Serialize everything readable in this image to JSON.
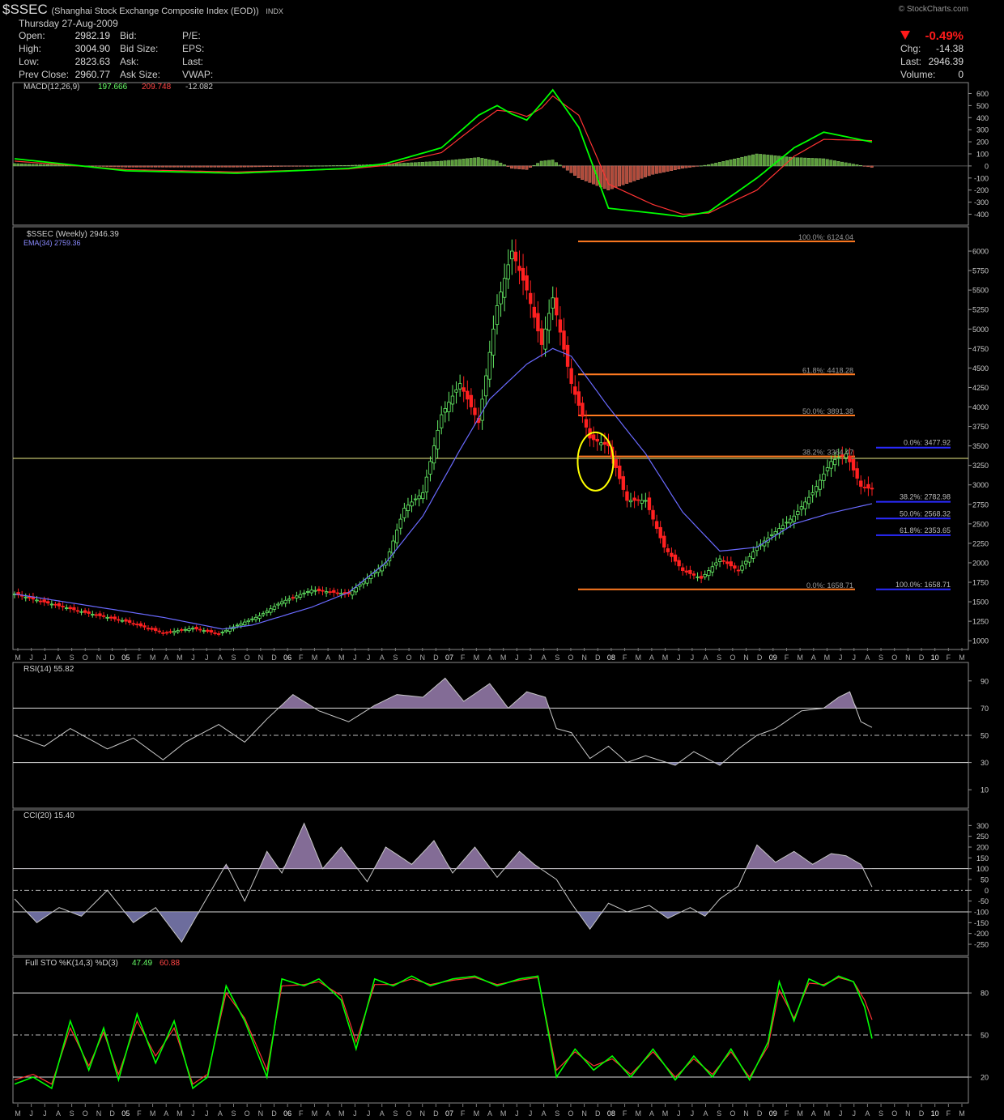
{
  "header": {
    "symbol": "$SSEC",
    "name": "(Shanghai Stock Exchange Composite Index (EOD))",
    "exchange": "INDX",
    "date": "Thursday  27-Aug-2009",
    "brand": "© StockCharts.com",
    "quotes_left": [
      {
        "label": "Open:",
        "value": "2982.19"
      },
      {
        "label": "High:",
        "value": "3004.90"
      },
      {
        "label": "Low:",
        "value": "2823.63"
      },
      {
        "label": "Prev Close:",
        "value": "2960.77"
      }
    ],
    "quotes_mid": [
      "Bid:",
      "Bid Size:",
      "Ask:",
      "Ask Size:"
    ],
    "quotes_right": [
      "P/E:",
      "EPS:",
      "Last:",
      "VWAP:"
    ],
    "change_pct": "-0.49%",
    "change_rows": [
      {
        "label": "Chg:",
        "value": "-14.38"
      },
      {
        "label": "Last:",
        "value": "2946.39"
      },
      {
        "label": "Volume:",
        "value": "0"
      }
    ],
    "colors": {
      "down": "#ff1a1a",
      "up": "#66ff66"
    }
  },
  "x_axis_labels": [
    "M",
    "J",
    "J",
    "A",
    "S",
    "O",
    "N",
    "D",
    "05",
    "F",
    "M",
    "A",
    "M",
    "J",
    "J",
    "A",
    "S",
    "O",
    "N",
    "D",
    "06",
    "F",
    "M",
    "A",
    "M",
    "J",
    "J",
    "A",
    "S",
    "O",
    "N",
    "D",
    "07",
    "F",
    "M",
    "A",
    "M",
    "J",
    "J",
    "A",
    "S",
    "O",
    "N",
    "D",
    "08",
    "F",
    "M",
    "A",
    "M",
    "J",
    "J",
    "A",
    "S",
    "O",
    "N",
    "D",
    "09",
    "F",
    "M",
    "A",
    "M",
    "J",
    "J",
    "A",
    "S",
    "O",
    "N",
    "D",
    "10",
    "F",
    "M"
  ],
  "chart_data": [
    {
      "panel": "macd",
      "type": "line",
      "legend": "MACD(12,26,9)",
      "legend_values": [
        "197.666",
        "209.748",
        "-12.082"
      ],
      "ylim": [
        -450,
        650
      ],
      "y_ticks": [
        600,
        500,
        400,
        300,
        200,
        100,
        0,
        -100,
        -200,
        -300,
        -400
      ],
      "x_weeks": [
        0,
        30,
        60,
        90,
        100,
        115,
        125,
        130,
        134,
        138,
        142,
        145,
        152,
        160,
        172,
        180,
        187,
        200,
        210,
        218,
        231
      ],
      "series": [
        {
          "name": "MACD",
          "color": "#00ff00",
          "values": [
            60,
            -40,
            -60,
            -20,
            20,
            150,
            420,
            500,
            430,
            380,
            520,
            630,
            320,
            -350,
            -390,
            -420,
            -380,
            -100,
            150,
            280,
            198
          ]
        },
        {
          "name": "Signal",
          "color": "#ff3333",
          "values": [
            40,
            -30,
            -50,
            -25,
            5,
            110,
            350,
            460,
            450,
            410,
            480,
            580,
            420,
            -150,
            -320,
            -400,
            -390,
            -200,
            80,
            220,
            210
          ]
        }
      ]
    },
    {
      "panel": "price",
      "type": "candlestick",
      "legend": "$SSEC (Weekly) 2946.39",
      "ema_legend": "EMA(34) 2759.36",
      "ylim": [
        950,
        6250
      ],
      "y_ticks": [
        6000,
        5750,
        5500,
        5250,
        5000,
        4750,
        4500,
        4250,
        4000,
        3750,
        3500,
        3250,
        3000,
        2750,
        2500,
        2250,
        2000,
        1750,
        1500,
        1250,
        1000
      ],
      "x_weeks": [
        0,
        10,
        20,
        30,
        40,
        48,
        55,
        60,
        66,
        72,
        80,
        90,
        100,
        105,
        110,
        115,
        120,
        125,
        130,
        134,
        138,
        142,
        145,
        150,
        155,
        160,
        165,
        170,
        175,
        180,
        185,
        190,
        195,
        200,
        205,
        210,
        215,
        220,
        224,
        228,
        231
      ],
      "close": [
        1600,
        1470,
        1350,
        1250,
        1100,
        1160,
        1090,
        1200,
        1320,
        1500,
        1650,
        1600,
        2000,
        2700,
        2900,
        3900,
        4300,
        3800,
        5300,
        6000,
        5500,
        4800,
        5400,
        4300,
        3600,
        3500,
        2800,
        2800,
        2200,
        1900,
        1800,
        2050,
        1900,
        2200,
        2400,
        2600,
        2900,
        3300,
        3400,
        2980,
        2946.39
      ],
      "ema_weeks": [
        0,
        40,
        56,
        64,
        80,
        90,
        100,
        110,
        120,
        128,
        138,
        145,
        150,
        160,
        170,
        180,
        190,
        200,
        210,
        220,
        231
      ],
      "ema": [
        1600,
        1300,
        1150,
        1200,
        1430,
        1620,
        2000,
        2600,
        3450,
        4100,
        4550,
        4750,
        4650,
        4000,
        3400,
        2650,
        2150,
        2200,
        2500,
        2640,
        2759.36
      ],
      "horizontal_line": 3340,
      "fib_orange": [
        {
          "label": "100.0%: 6124.04",
          "level": 6124.04
        },
        {
          "label": "61.8%: 4418.28",
          "level": 4418.28
        },
        {
          "label": "50.0%: 3891.38",
          "level": 3891.38
        },
        {
          "label": "38.2%: 3364.47",
          "level": 3364.47
        },
        {
          "label": "0.0%: 1658.71",
          "level": 1658.71
        }
      ],
      "fib_blue": [
        {
          "label": "0.0%: 3477.92",
          "level": 3477.92
        },
        {
          "label": "38.2%: 2782.98",
          "level": 2782.98
        },
        {
          "label": "50.0%: 2568.32",
          "level": 2568.32
        },
        {
          "label": "61.8%: 2353.65",
          "level": 2353.65
        },
        {
          "label": "100.0%: 1658.71",
          "level": 1658.71
        }
      ],
      "circle_annotation": {
        "week": 156.5,
        "price": 3300,
        "color": "#ffff00"
      }
    },
    {
      "panel": "rsi",
      "type": "area",
      "legend": "RSI(14) 55.82",
      "ylim": [
        0,
        100
      ],
      "y_ticks": [
        90,
        70,
        50,
        30,
        10
      ],
      "ref_lines": [
        70,
        50,
        30
      ],
      "x_weeks": [
        0,
        8,
        15,
        25,
        32,
        40,
        46,
        55,
        62,
        68,
        75,
        82,
        90,
        97,
        103,
        110,
        116,
        121,
        128,
        133,
        138,
        143,
        146,
        150,
        155,
        160,
        165,
        170,
        178,
        183,
        190,
        195,
        200,
        205,
        212,
        218,
        222,
        225,
        228,
        231
      ],
      "values": [
        50,
        42,
        55,
        40,
        48,
        32,
        45,
        58,
        45,
        62,
        80,
        68,
        60,
        72,
        80,
        78,
        92,
        75,
        88,
        70,
        82,
        78,
        55,
        52,
        33,
        42,
        30,
        35,
        28,
        38,
        28,
        40,
        50,
        55,
        68,
        70,
        78,
        82,
        60,
        55.82
      ]
    },
    {
      "panel": "cci",
      "type": "area",
      "legend": "CCI(20) 15.40",
      "ylim": [
        -280,
        350
      ],
      "y_ticks": [
        300,
        250,
        200,
        150,
        100,
        50,
        0,
        -50,
        -100,
        -150,
        -200,
        -250
      ],
      "ref_lines": [
        100,
        0,
        -100
      ],
      "x_weeks": [
        0,
        6,
        12,
        18,
        25,
        32,
        38,
        45,
        52,
        57,
        62,
        68,
        72,
        78,
        83,
        88,
        95,
        100,
        107,
        113,
        118,
        124,
        130,
        136,
        140,
        146,
        150,
        155,
        160,
        165,
        171,
        176,
        182,
        186,
        190,
        195,
        200,
        205,
        210,
        215,
        220,
        224,
        228,
        231
      ],
      "values": [
        -40,
        -150,
        -80,
        -120,
        0,
        -150,
        -80,
        -240,
        -30,
        120,
        -50,
        180,
        80,
        310,
        100,
        200,
        40,
        200,
        120,
        230,
        80,
        200,
        60,
        180,
        120,
        50,
        -60,
        -180,
        -60,
        -100,
        -70,
        -130,
        -80,
        -120,
        -40,
        20,
        210,
        130,
        180,
        120,
        170,
        160,
        120,
        15.4
      ]
    },
    {
      "panel": "stoch",
      "type": "line",
      "legend": "Full STO %K(14,3) %D(3)",
      "legend_values": [
        "47.49",
        "60.88"
      ],
      "ylim": [
        5,
        102
      ],
      "y_ticks": [
        80,
        50,
        20
      ],
      "ref_lines": [
        80,
        50,
        20
      ],
      "x_weeks": [
        0,
        5,
        10,
        15,
        20,
        24,
        28,
        33,
        38,
        43,
        48,
        52,
        57,
        62,
        68,
        72,
        78,
        82,
        88,
        92,
        97,
        102,
        107,
        112,
        118,
        124,
        130,
        136,
        141,
        146,
        151,
        156,
        161,
        166,
        172,
        178,
        183,
        188,
        193,
        198,
        203,
        206,
        210,
        214,
        218,
        222,
        226,
        229,
        231
      ],
      "series": [
        {
          "name": "%K",
          "color": "#00ff00",
          "values": [
            15,
            20,
            12,
            60,
            25,
            55,
            18,
            65,
            30,
            60,
            12,
            20,
            85,
            60,
            20,
            90,
            85,
            90,
            75,
            40,
            90,
            85,
            92,
            85,
            90,
            92,
            85,
            90,
            92,
            20,
            40,
            25,
            35,
            20,
            40,
            18,
            35,
            20,
            40,
            18,
            45,
            88,
            60,
            90,
            85,
            92,
            88,
            70,
            47.49
          ]
        },
        {
          "name": "%D",
          "color": "#ff3333",
          "values": [
            18,
            22,
            15,
            55,
            28,
            52,
            22,
            60,
            35,
            55,
            15,
            22,
            80,
            62,
            25,
            85,
            86,
            88,
            78,
            45,
            86,
            86,
            90,
            86,
            89,
            91,
            86,
            89,
            91,
            25,
            38,
            28,
            33,
            22,
            38,
            20,
            33,
            22,
            38,
            20,
            42,
            82,
            62,
            87,
            86,
            91,
            88,
            75,
            60.88
          ]
        }
      ]
    }
  ]
}
